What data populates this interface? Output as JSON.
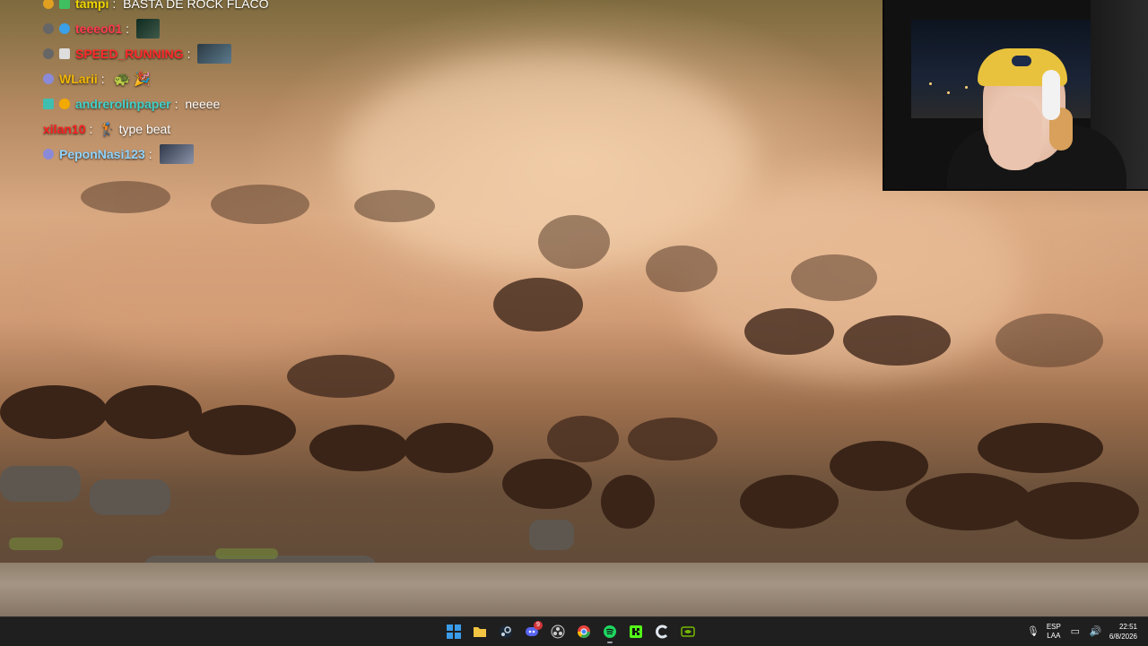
{
  "chat": {
    "messages": [
      {
        "user": "tampi",
        "user_color": "#f0d600",
        "text": "BASTA DE ROCK FLACO",
        "badges": [
          "#e0a020",
          "#3fbf5f"
        ],
        "emote": false
      },
      {
        "user": "teeeo01",
        "user_color": "#ff3b4e",
        "text": "",
        "badges": [
          "#666666",
          "#3aa0e8"
        ],
        "emote": true
      },
      {
        "user": "SPEED_RUNNING",
        "user_color": "#ff2a2a",
        "text": "",
        "badges": [
          "#666666",
          "#dddddd"
        ],
        "emote": true
      },
      {
        "user": "WLarii",
        "user_color": "#f2b705",
        "text": "🐢 🎉",
        "badges": [
          "#8a8ad8"
        ],
        "emote": false
      },
      {
        "user": "andrerolinpaper",
        "user_color": "#3fd0c9",
        "text": "neeee",
        "badges": [
          "#3fbfb0",
          "#f2a900"
        ],
        "emote": false
      },
      {
        "user": "xilan10",
        "user_color": "#ff2020",
        "text": "🏌 type beat",
        "badges": [],
        "emote": false
      },
      {
        "user": "PeponNasi123",
        "user_color": "#8fd3ff",
        "text": "",
        "badges": [
          "#8a8ad8"
        ],
        "emote": true
      }
    ]
  },
  "taskbar": {
    "apps": [
      {
        "name": "start",
        "color": "#3a9be8",
        "active": false
      },
      {
        "name": "file-explorer",
        "color": "#f4c542",
        "active": false
      },
      {
        "name": "steam",
        "color": "#c7d5e0",
        "active": false
      },
      {
        "name": "discord",
        "color": "#5865f2",
        "active": false,
        "badge": "9"
      },
      {
        "name": "obs",
        "color": "#cfcfcf",
        "active": false
      },
      {
        "name": "chrome",
        "color": "#e8453c",
        "active": false
      },
      {
        "name": "spotify",
        "color": "#1ed760",
        "active": true
      },
      {
        "name": "kick",
        "color": "#53fc18",
        "active": false
      },
      {
        "name": "ccleaner",
        "color": "#dfe7ef",
        "active": false
      },
      {
        "name": "nvidia-app",
        "color": "#76b900",
        "active": false
      }
    ],
    "lang_top": "ESP",
    "lang_bottom": "LAA",
    "time": "22:51",
    "date": "6/8/2026"
  }
}
